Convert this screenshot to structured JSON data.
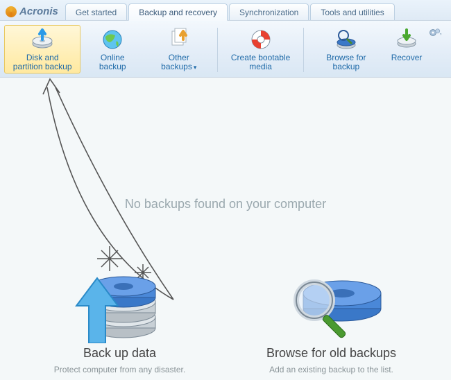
{
  "brand": "Acronis",
  "tabs": [
    {
      "label": "Get started",
      "active": false
    },
    {
      "label": "Backup and recovery",
      "active": true
    },
    {
      "label": "Synchronization",
      "active": false
    },
    {
      "label": "Tools and utilities",
      "active": false
    }
  ],
  "toolbar": {
    "disk_partition": "Disk and partition backup",
    "online_backup": "Online backup",
    "other_backups": "Other backups",
    "create_media": "Create bootable media",
    "browse_backup": "Browse for backup",
    "recover": "Recover"
  },
  "main": {
    "status": "No backups found on your computer",
    "backup": {
      "title": "Back up data",
      "subtitle": "Protect computer from any disaster."
    },
    "browse": {
      "title": "Browse for old backups",
      "subtitle": "Add an existing backup to the list."
    }
  }
}
